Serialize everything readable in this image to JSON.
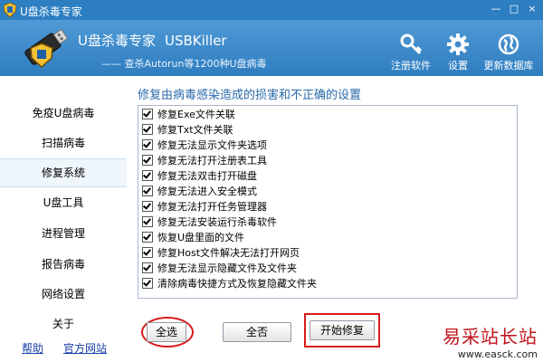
{
  "window": {
    "title": "U盘杀毒专家",
    "controls": [
      "—",
      "□",
      "×"
    ]
  },
  "header": {
    "app_name": "U盘杀毒专家",
    "app_name_en": "USBKiller",
    "subtitle": "—— 查杀Autorun等1200种U盘病毒",
    "tools": [
      {
        "label": "注册软件",
        "icon": "key-icon"
      },
      {
        "label": "设置",
        "icon": "gear-icon"
      },
      {
        "label": "更新数据库",
        "icon": "globe-icon"
      }
    ]
  },
  "sidebar": {
    "items": [
      {
        "label": "免疫U盘病毒"
      },
      {
        "label": "扫描病毒"
      },
      {
        "label": "修复系统",
        "active": true
      },
      {
        "label": "U盘工具"
      },
      {
        "label": "进程管理"
      },
      {
        "label": "报告病毒"
      },
      {
        "label": "网络设置"
      },
      {
        "label": "关于"
      }
    ],
    "links": {
      "help": "帮助",
      "site": "官方网站"
    }
  },
  "main": {
    "title": "修复由病毒感染造成的损害和不正确的设置",
    "options": [
      {
        "label": "修复Exe文件关联",
        "checked": true
      },
      {
        "label": "修复Txt文件关联",
        "checked": true
      },
      {
        "label": "修复无法显示文件夹选项",
        "checked": true
      },
      {
        "label": "修复无法打开注册表工具",
        "checked": true
      },
      {
        "label": "修复无法双击打开磁盘",
        "checked": true
      },
      {
        "label": "修复无法进入安全模式",
        "checked": true
      },
      {
        "label": "修复无法打开任务管理器",
        "checked": true
      },
      {
        "label": "修复无法安装运行杀毒软件",
        "checked": true
      },
      {
        "label": "恢复U盘里面的文件",
        "checked": true
      },
      {
        "label": "修复Host文件解决无法打开网页",
        "checked": true
      },
      {
        "label": "修复无法显示隐藏文件及文件夹",
        "checked": true
      },
      {
        "label": "清除病毒快捷方式及恢复隐藏文件夹",
        "checked": true
      }
    ],
    "buttons": {
      "select_all": "全选",
      "select_none": "全否",
      "start_repair": "开始修复"
    }
  },
  "watermark": {
    "cn": "易采站长站",
    "url": "www.easck.com"
  },
  "colors": {
    "titlebar": "#2e7fc2",
    "header": "#3f8ccd",
    "accent_text": "#2a6aaa",
    "highlight_ring": "#d81b1b"
  }
}
